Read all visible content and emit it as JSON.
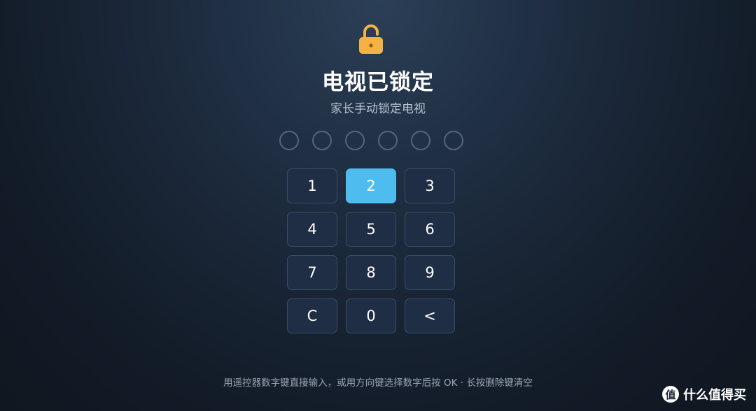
{
  "lock": {
    "icon": "padlock-icon",
    "color": "#f5b244"
  },
  "title": "电视已锁定",
  "subtitle": "家长手动锁定电视",
  "pin": {
    "length": 6,
    "filled": 0
  },
  "keypad": {
    "active_color": "#4fbcf0",
    "keys": [
      {
        "label": "1",
        "active": false
      },
      {
        "label": "2",
        "active": true
      },
      {
        "label": "3",
        "active": false
      },
      {
        "label": "4",
        "active": false
      },
      {
        "label": "5",
        "active": false
      },
      {
        "label": "6",
        "active": false
      },
      {
        "label": "7",
        "active": false
      },
      {
        "label": "8",
        "active": false
      },
      {
        "label": "9",
        "active": false
      },
      {
        "label": "C",
        "active": false
      },
      {
        "label": "0",
        "active": false
      },
      {
        "label": "<",
        "active": false
      }
    ]
  },
  "hint": "用遥控器数字键直接输入，或用方向键选择数字后按 OK · 长按删除键清空",
  "watermark": {
    "logo": "值",
    "text": "什么值得买"
  }
}
